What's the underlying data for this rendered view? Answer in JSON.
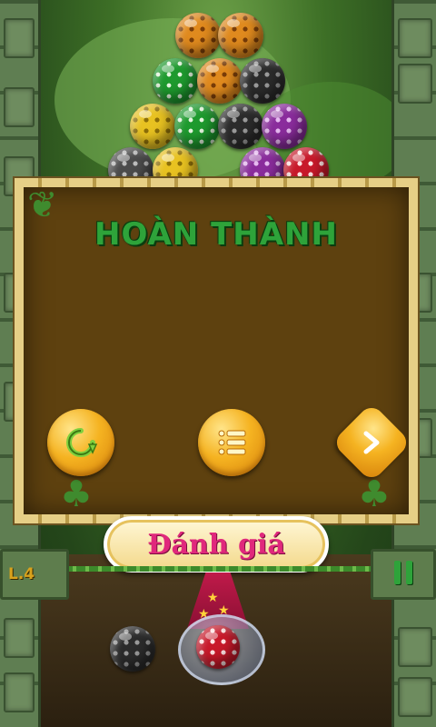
{
  "panel": {
    "title": "HOÀN THÀNH"
  },
  "buttons": {
    "rate_label": "Đánh giá"
  },
  "hud": {
    "level": "L.4"
  },
  "icons": {
    "replay": "replay-icon",
    "menu": "menu-list-icon",
    "next": "next-arrow-icon",
    "pause": "pause-icon"
  },
  "colors": {
    "title_green": "#2ea33a",
    "button_gold": "#f5b321",
    "rate_pink": "#e0287c",
    "panel_brown": "#5e410f"
  },
  "bubbles": {
    "top_cluster": [
      "orange",
      "orange",
      "green",
      "orange",
      "black",
      "yellow",
      "green",
      "black",
      "purple",
      "grey",
      "yellow",
      "purple",
      "red"
    ],
    "next_ball": "black",
    "current_ball": "red"
  }
}
